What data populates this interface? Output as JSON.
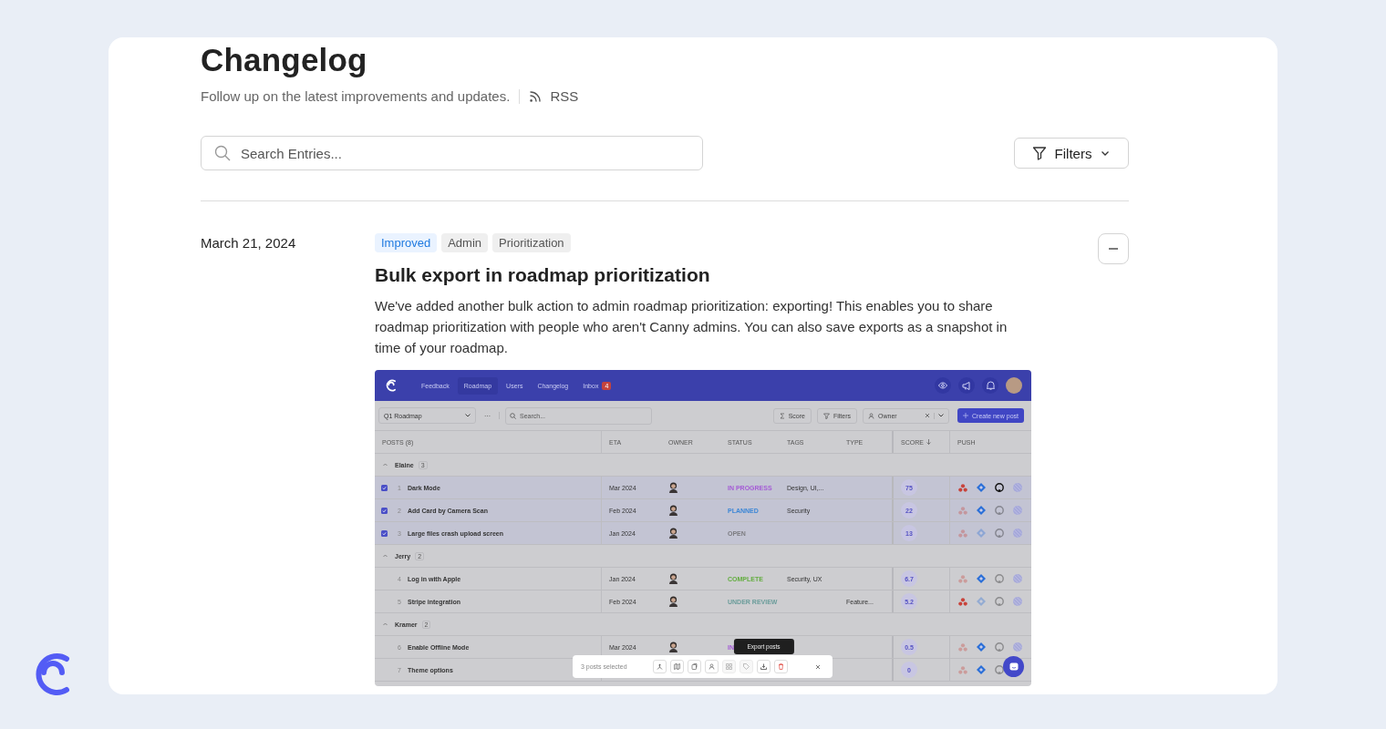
{
  "header": {
    "title": "Changelog",
    "subtitle": "Follow up on the latest improvements and updates.",
    "rss_label": "RSS"
  },
  "search": {
    "placeholder": "Search Entries..."
  },
  "filters_button": {
    "label": "Filters"
  },
  "entries": [
    {
      "date": "March 21, 2024",
      "expanded": true,
      "tags": [
        {
          "label": "Improved",
          "kind": "highlight"
        },
        {
          "label": "Admin",
          "kind": "plain"
        },
        {
          "label": "Prioritization",
          "kind": "plain"
        }
      ],
      "title": "Bulk export in roadmap prioritization",
      "body": "We've added another bulk action to admin roadmap prioritization: exporting! This enables you to share roadmap prioritization with people who aren't Canny admins. You can also save exports as a snapshot in time of your roadmap.",
      "screenshot": {
        "nav": [
          {
            "label": "Feedback",
            "selected": false
          },
          {
            "label": "Roadmap",
            "selected": true
          },
          {
            "label": "Users",
            "selected": false
          },
          {
            "label": "Changelog",
            "selected": false
          },
          {
            "label": "Inbox",
            "selected": false,
            "badge": "4"
          }
        ],
        "toolbar": {
          "roadmap": "Q1 Roadmap",
          "more": "···",
          "search_placeholder": "Search...",
          "score": "Score",
          "filters": "Filters",
          "owner": "Owner",
          "create": "Create new post"
        },
        "columns": [
          "POSTS (8)",
          "ETA",
          "OWNER",
          "STATUS",
          "TAGS",
          "TYPE",
          "SCORE",
          "PUSH"
        ],
        "groups": [
          {
            "name": "Elaine",
            "count": "3",
            "expanded": true,
            "posts": [
              {
                "number": "1",
                "title": "Dark Mode",
                "checked": true,
                "eta": "Mar 2024",
                "avatar": true,
                "status": {
                  "label": "IN PROGRESS",
                  "color": "#a55bd6"
                },
                "tags": "Design, UI,...",
                "score": "75",
                "push": {
                  "asana": true,
                  "jira": true,
                  "github": true,
                  "linear": true
                }
              },
              {
                "number": "2",
                "title": "Add Card by Camera Scan",
                "checked": true,
                "eta": "Feb 2024",
                "avatar": true,
                "status": {
                  "label": "PLANNED",
                  "color": "#3b86d6"
                },
                "tags": "Security",
                "score": "22",
                "push": {
                  "asana": false,
                  "jira": true,
                  "github": false,
                  "linear": true
                }
              },
              {
                "number": "3",
                "title": "Large files crash upload screen",
                "checked": true,
                "eta": "Jan 2024",
                "avatar": true,
                "status": {
                  "label": "OPEN",
                  "color": "#7c7c80"
                },
                "score": "13",
                "push": {
                  "asana": false,
                  "jira": false,
                  "github": false,
                  "linear": true
                }
              }
            ]
          },
          {
            "name": "Jerry",
            "count": "2",
            "expanded": true,
            "posts": [
              {
                "number": "4",
                "title": "Log in with Apple",
                "checked": false,
                "eta": "Jan 2024",
                "avatar": true,
                "status": {
                  "label": "COMPLETE",
                  "color": "#62ad3e"
                },
                "tags": "Security, UX",
                "score": "6.7",
                "push": {
                  "asana": false,
                  "jira": true,
                  "github": false,
                  "linear": true
                }
              },
              {
                "number": "5",
                "title": "Stripe integration",
                "checked": false,
                "eta": "Feb 2024",
                "avatar": true,
                "status": {
                  "label": "UNDER REVIEW",
                  "color": "#6a9c9a"
                },
                "type": "Feature...",
                "score": "5.2",
                "push": {
                  "asana": true,
                  "jira": false,
                  "github": false,
                  "linear": true
                }
              }
            ]
          },
          {
            "name": "Kramer",
            "count": "2",
            "expanded": true,
            "posts": [
              {
                "number": "6",
                "title": "Enable Offline Mode",
                "checked": false,
                "eta": "Mar 2024",
                "avatar": true,
                "status": {
                  "label": "IN",
                  "color": "#a55bd6"
                },
                "score": "0.5",
                "push": {
                  "asana": false,
                  "jira": true,
                  "github": false,
                  "linear": true
                }
              },
              {
                "number": "7",
                "title": "Theme options",
                "checked": false,
                "avatar": false,
                "score": "0",
                "push": {
                  "asana": false,
                  "jira": true,
                  "github": false,
                  "linear": false
                }
              }
            ]
          }
        ],
        "bulk_bar": {
          "selected_text": "3 posts selected",
          "actions": [
            {
              "kind": "merge",
              "disabled": false
            },
            {
              "kind": "map",
              "disabled": false
            },
            {
              "kind": "move",
              "disabled": false
            },
            {
              "kind": "owner",
              "disabled": false
            },
            {
              "kind": "group",
              "disabled": true
            },
            {
              "kind": "tag",
              "disabled": true
            },
            {
              "kind": "export",
              "disabled": false,
              "tooltip": "Export posts"
            },
            {
              "kind": "delete",
              "disabled": false
            }
          ]
        }
      }
    }
  ]
}
